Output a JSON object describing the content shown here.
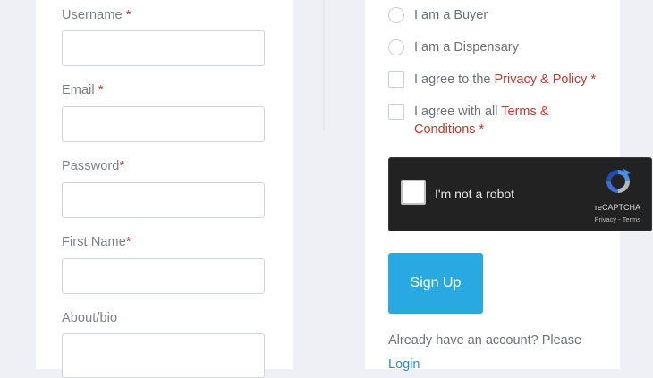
{
  "form_left": {
    "username": {
      "label": "Username",
      "required": "*"
    },
    "email": {
      "label": "Email",
      "required": "*"
    },
    "password": {
      "label": "Password",
      "required": "*"
    },
    "first_name": {
      "label": "First Name",
      "required": "*"
    },
    "about": {
      "label": "About/bio"
    }
  },
  "form_right": {
    "role_buyer": "I am a Buyer",
    "role_dispensary": "I am a Dispensary",
    "privacy_prefix": "I agree to the ",
    "privacy_link": "Privacy & Policy",
    "privacy_req": " *",
    "terms_prefix": "I agree with all ",
    "terms_link_1": "Terms &",
    "terms_link_2": "Conditions",
    "terms_req": " *"
  },
  "recaptcha": {
    "label": "I'm not a robot",
    "brand": "reCAPTCHA",
    "links": "Privacy - Terms"
  },
  "signup_button": "Sign Up",
  "footer": {
    "prompt": "Already have an account? Please",
    "login": "Login"
  },
  "colors": {
    "accent": "#29a9e1",
    "required": "#d0342c",
    "link": "#2a8ccf"
  }
}
